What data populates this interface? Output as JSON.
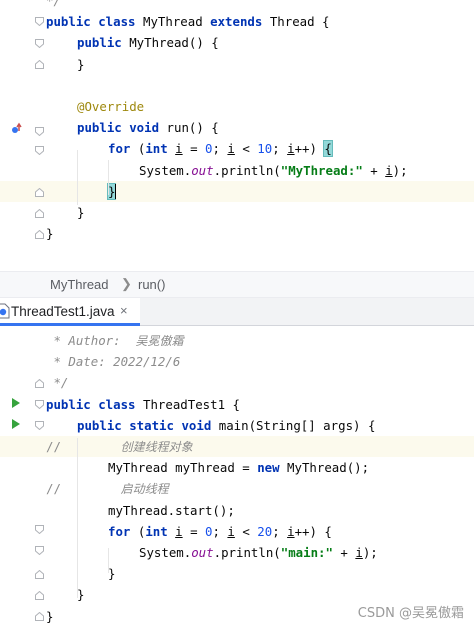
{
  "top_code": [
    {
      "indent": 0,
      "tokens": [
        {
          "t": "*/",
          "c": "doc"
        }
      ]
    },
    {
      "indent": 0,
      "tokens": [
        {
          "t": "public ",
          "c": "kw"
        },
        {
          "t": "class ",
          "c": "kw"
        },
        {
          "t": "MyThread "
        },
        {
          "t": "extends ",
          "c": "kw"
        },
        {
          "t": "Thread {"
        }
      ]
    },
    {
      "indent": 1,
      "tokens": [
        {
          "t": "public ",
          "c": "kw"
        },
        {
          "t": "MyThread() {"
        }
      ]
    },
    {
      "indent": 1,
      "tokens": [
        {
          "t": "}"
        }
      ]
    },
    {
      "indent": 0,
      "tokens": []
    },
    {
      "indent": 1,
      "tokens": [
        {
          "t": "@Override",
          "c": "ann"
        }
      ]
    },
    {
      "indent": 1,
      "tokens": [
        {
          "t": "public ",
          "c": "kw"
        },
        {
          "t": "void ",
          "c": "kw"
        },
        {
          "t": "run() {"
        }
      ]
    },
    {
      "indent": 2,
      "tokens": [
        {
          "t": "for ",
          "c": "kw"
        },
        {
          "t": "("
        },
        {
          "t": "int ",
          "c": "kw"
        },
        {
          "t": "i",
          "c": "ul"
        },
        {
          "t": " = "
        },
        {
          "t": "0",
          "c": "num"
        },
        {
          "t": "; "
        },
        {
          "t": "i",
          "c": "ul"
        },
        {
          "t": " < "
        },
        {
          "t": "10",
          "c": "num"
        },
        {
          "t": "; "
        },
        {
          "t": "i",
          "c": "ul"
        },
        {
          "t": "++) "
        },
        {
          "t": "{",
          "c": "brace-hl"
        }
      ]
    },
    {
      "indent": 3,
      "tokens": [
        {
          "t": "System."
        },
        {
          "t": "out",
          "c": "fld"
        },
        {
          "t": ".println("
        },
        {
          "t": "\"MyThread:\"",
          "c": "str"
        },
        {
          "t": " + "
        },
        {
          "t": "i",
          "c": "ul"
        },
        {
          "t": ");"
        }
      ]
    },
    {
      "indent": 2,
      "tokens": [
        {
          "t": "}",
          "c": "brace-hl"
        }
      ],
      "caret": true
    },
    {
      "indent": 1,
      "tokens": [
        {
          "t": "}"
        }
      ]
    },
    {
      "indent": 0,
      "tokens": [
        {
          "t": "}"
        }
      ]
    }
  ],
  "breadcrumb": {
    "class_name": "MyThread",
    "separator": "❯",
    "method_name": "run()"
  },
  "tab": {
    "label": "ThreadTest1.java",
    "close": "×"
  },
  "bottom_code": [
    {
      "indent": 0,
      "tokens": [
        {
          "t": " * Author:  ",
          "c": "doc"
        },
        {
          "t": "吴冕傲霜",
          "c": "doc-cn"
        }
      ]
    },
    {
      "indent": 0,
      "tokens": [
        {
          "t": " * Date: 2022/12/6",
          "c": "doc"
        }
      ]
    },
    {
      "indent": 0,
      "tokens": [
        {
          "t": " */",
          "c": "doc"
        }
      ]
    },
    {
      "indent": 0,
      "tokens": [
        {
          "t": "public ",
          "c": "kw"
        },
        {
          "t": "class ",
          "c": "kw"
        },
        {
          "t": "ThreadTest1 {"
        }
      ]
    },
    {
      "indent": 1,
      "tokens": [
        {
          "t": "public ",
          "c": "kw"
        },
        {
          "t": "static ",
          "c": "kw"
        },
        {
          "t": "void ",
          "c": "kw"
        },
        {
          "t": "main(String[] args) {"
        }
      ]
    },
    {
      "indent": 0,
      "tokens": [
        {
          "t": "//        ",
          "c": "cmt"
        },
        {
          "t": "创建线程对象",
          "c": "cmt-cn"
        }
      ],
      "comment": true
    },
    {
      "indent": 2,
      "tokens": [
        {
          "t": "MyThread myThread = "
        },
        {
          "t": "new ",
          "c": "kw"
        },
        {
          "t": "MyThread();"
        }
      ]
    },
    {
      "indent": 0,
      "tokens": [
        {
          "t": "//        ",
          "c": "cmt"
        },
        {
          "t": "启动线程",
          "c": "cmt-cn"
        }
      ]
    },
    {
      "indent": 2,
      "tokens": [
        {
          "t": "myThread.start();"
        }
      ]
    },
    {
      "indent": 2,
      "tokens": [
        {
          "t": "for ",
          "c": "kw"
        },
        {
          "t": "("
        },
        {
          "t": "int ",
          "c": "kw"
        },
        {
          "t": "i",
          "c": "ul"
        },
        {
          "t": " = "
        },
        {
          "t": "0",
          "c": "num"
        },
        {
          "t": "; "
        },
        {
          "t": "i",
          "c": "ul"
        },
        {
          "t": " < "
        },
        {
          "t": "20",
          "c": "num"
        },
        {
          "t": "; "
        },
        {
          "t": "i",
          "c": "ul"
        },
        {
          "t": "++) {"
        }
      ]
    },
    {
      "indent": 3,
      "tokens": [
        {
          "t": "System."
        },
        {
          "t": "out",
          "c": "fld"
        },
        {
          "t": ".println("
        },
        {
          "t": "\"main:\"",
          "c": "str"
        },
        {
          "t": " + "
        },
        {
          "t": "i",
          "c": "ul"
        },
        {
          "t": ");"
        }
      ]
    },
    {
      "indent": 2,
      "tokens": [
        {
          "t": "}"
        }
      ]
    },
    {
      "indent": 1,
      "tokens": [
        {
          "t": "}"
        }
      ]
    },
    {
      "indent": 0,
      "tokens": [
        {
          "t": "}"
        }
      ]
    }
  ],
  "gutter": {
    "top_override_marker_icon": "override-marker-icon",
    "bottom_run_icons": [
      "run-class-icon",
      "run-main-icon"
    ]
  },
  "watermark": "CSDN @吴冕傲霜",
  "colors": {
    "keyword": "#0033b3",
    "annotation": "#9e880d",
    "string": "#067d17",
    "number": "#1750eb",
    "field": "#871094",
    "comment": "#8c8c8c",
    "caret_line": "#fcfaed",
    "tab_underline": "#3574f0",
    "run_icon": "#36a33d"
  }
}
